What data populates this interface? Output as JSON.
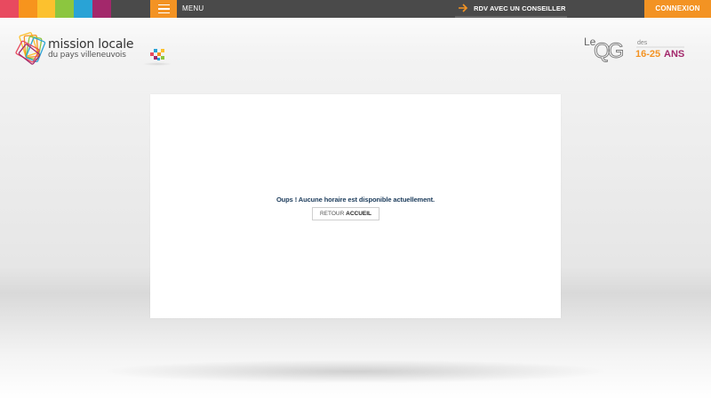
{
  "header": {
    "color_strip": [
      "#e84a5f",
      "#f7941d",
      "#fcc12e",
      "#8cc63f",
      "#29a3d6",
      "#a3286b"
    ],
    "menu_label": "MENU",
    "rdv_label": "RDV AVEC UN CONSEILLER",
    "connexion_label": "CONNEXION",
    "accent_color": "#f39323",
    "bar_color": "#4a4a4a"
  },
  "logo": {
    "title": "mission locale",
    "subtitle": "du pays villeneuvois",
    "icon": "colored-cards-icon"
  },
  "qg_logo": {
    "le": "Le",
    "qg": "QG",
    "des": "des",
    "ages": "16-25",
    "ans": "ANS"
  },
  "main": {
    "message": "Oups ! Aucune horaire est disponible actuellement.",
    "retour_prefix": "RETOUR",
    "retour_strong": "ACCUEIL"
  },
  "icons": {
    "menu": "hamburger-icon",
    "rdv": "arrow-right-icon",
    "pixels": "pixel-squares-icon"
  }
}
